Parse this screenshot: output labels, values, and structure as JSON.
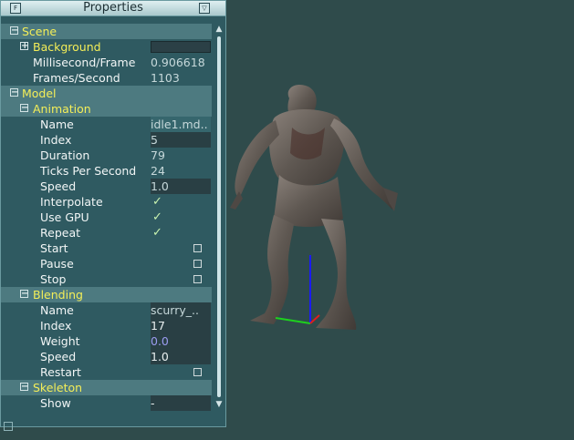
{
  "panel": {
    "title": "Properties",
    "scene": {
      "label": "Scene",
      "background": "Background",
      "ms_frame_label": "Millisecond/Frame",
      "ms_frame_value": "0.906618",
      "fps_label": "Frames/Second",
      "fps_value": "1103"
    },
    "model": {
      "label": "Model",
      "animation": {
        "label": "Animation",
        "rows": [
          {
            "label": "Name",
            "value": "idle1.md.."
          },
          {
            "label": "Index",
            "value": "5"
          },
          {
            "label": "Duration",
            "value": "79"
          },
          {
            "label": "Ticks Per Second",
            "value": "24"
          },
          {
            "label": "Speed",
            "value": "1.0"
          },
          {
            "label": "Interpolate",
            "value": "✓"
          },
          {
            "label": "Use GPU",
            "value": "✓"
          },
          {
            "label": "Repeat",
            "value": "✓"
          },
          {
            "label": "Start"
          },
          {
            "label": "Pause"
          },
          {
            "label": "Stop"
          }
        ]
      },
      "blending": {
        "label": "Blending",
        "rows": [
          {
            "label": "Name",
            "value": "scurry_.."
          },
          {
            "label": "Index",
            "value": "17"
          },
          {
            "label": "Weight",
            "value": "0.0"
          },
          {
            "label": "Speed",
            "value": "1.0"
          },
          {
            "label": "Restart"
          }
        ]
      },
      "skeleton": {
        "label": "Skeleton",
        "rows": [
          {
            "label": "Show",
            "value": "-"
          }
        ]
      }
    }
  }
}
